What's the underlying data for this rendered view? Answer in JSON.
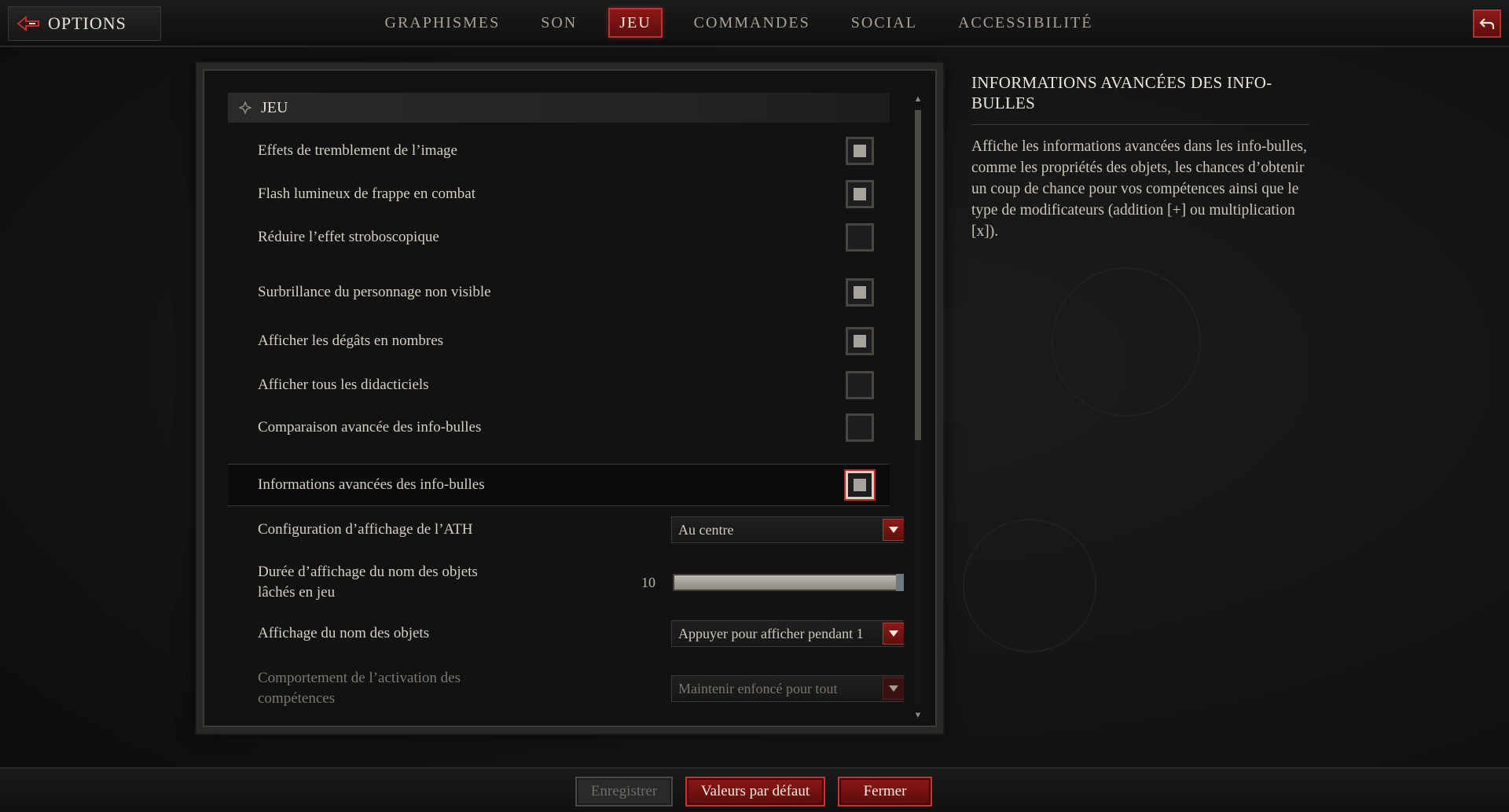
{
  "header": {
    "title": "OPTIONS",
    "tabs": [
      {
        "label": "GRAPHISMES"
      },
      {
        "label": "SON"
      },
      {
        "label": "JEU"
      },
      {
        "label": "COMMANDES"
      },
      {
        "label": "SOCIAL"
      },
      {
        "label": "ACCESSIBILITÉ"
      }
    ],
    "active_tab": "JEU"
  },
  "panel": {
    "section_title": "JEU",
    "settings": [
      {
        "label": "Effets de tremblement de l’image",
        "type": "checkbox",
        "checked": true
      },
      {
        "label": "Flash lumineux de frappe en combat",
        "type": "checkbox",
        "checked": true
      },
      {
        "label": "Réduire l’effet stroboscopique",
        "type": "checkbox",
        "checked": false
      },
      {
        "label": "Surbrillance du personnage non visible",
        "type": "checkbox",
        "checked": true
      },
      {
        "label": "Afficher les dégâts en nombres",
        "type": "checkbox",
        "checked": true
      },
      {
        "label": "Afficher tous les didacticiels",
        "type": "checkbox",
        "checked": false
      },
      {
        "label": "Comparaison avancée des info-bulles",
        "type": "checkbox",
        "checked": false
      },
      {
        "label": "Informations avancées des info-bulles",
        "type": "checkbox",
        "checked": true
      },
      {
        "label": "Configuration d’affichage de l’ATH",
        "type": "dropdown",
        "value": "Au centre"
      },
      {
        "label": "Durée d’affichage du nom des objets lâchés en jeu",
        "type": "slider",
        "value": "10",
        "fraction": 1.0
      },
      {
        "label": "Affichage du nom des objets",
        "type": "dropdown",
        "value": "Appuyer pour afficher pendant 1"
      },
      {
        "label": "Comportement de l’activation des compétences",
        "type": "dropdown",
        "value": "Maintenir enfoncé pour tout"
      }
    ]
  },
  "info": {
    "title": "INFORMATIONS AVANCÉES DES INFO-BULLES",
    "description": "Affiche les informations avancées dans les info-bulles, comme les propriétés des objets, les chances d’obtenir un coup de chance pour vos compétences ainsi que le type de modificateurs (addition [+] ou multiplication [x])."
  },
  "footer": {
    "save_label": "Enregistrer",
    "defaults_label": "Valeurs par défaut",
    "close_label": "Fermer"
  },
  "colors": {
    "accent_red": "#8e1717",
    "accent_border": "#c23535",
    "background": "#141414",
    "text": "#d6cfc3"
  }
}
